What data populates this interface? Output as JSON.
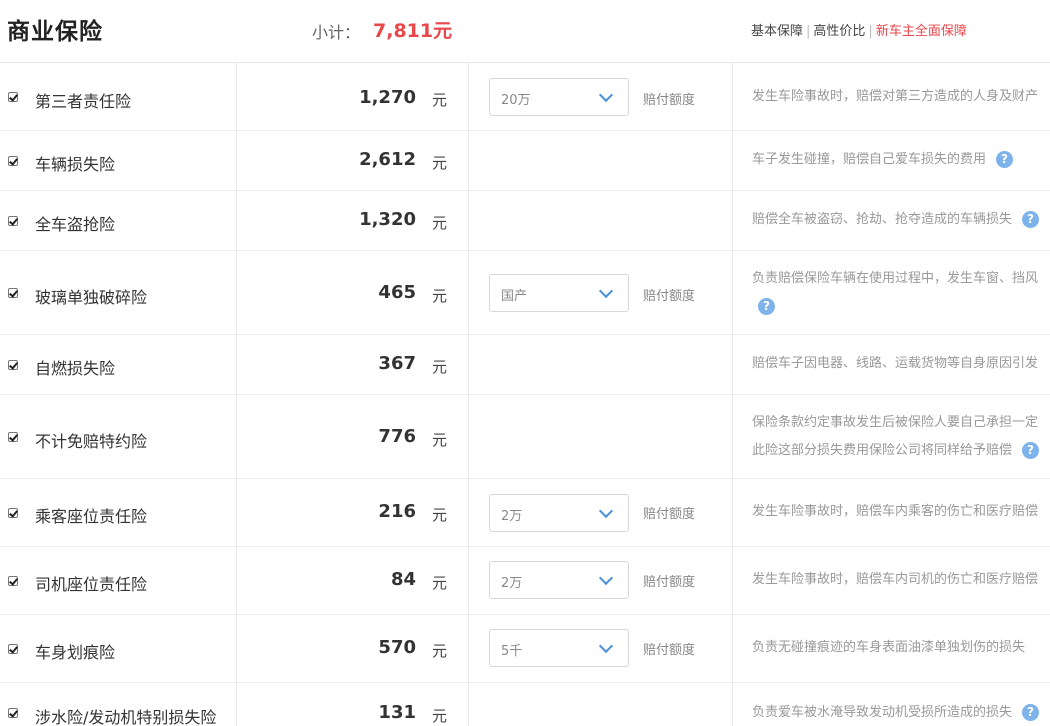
{
  "header": {
    "title": "商业保险",
    "subtotal_label": "小计：",
    "subtotal_value": "7,811元",
    "filters": [
      "基本保障",
      "高性价比",
      "新车主全面保障"
    ]
  },
  "unit": "元",
  "limit_label": "赔付额度",
  "items": [
    {
      "name": "第三者责任险",
      "price": "1,270",
      "select": "20万",
      "desc1": "发生车险事故时，赔偿对第三方造成的人身及财产",
      "desc2": ""
    },
    {
      "name": "车辆损失险",
      "price": "2,612",
      "select": "",
      "desc1": "车子发生碰撞，赔偿自己爱车损失的费用",
      "desc2": ""
    },
    {
      "name": "全车盗抢险",
      "price": "1,320",
      "select": "",
      "desc1": "赔偿全车被盗窃、抢劫、抢夺造成的车辆损失",
      "desc2": ""
    },
    {
      "name": "玻璃单独破碎险",
      "price": "465",
      "select": "国产",
      "desc1": "负责赔偿保险车辆在使用过程中，发生车窗、挡风",
      "desc2": ""
    },
    {
      "name": "自燃损失险",
      "price": "367",
      "select": "",
      "desc1": "赔偿车子因电器、线路、运载货物等自身原因引发",
      "desc2": ""
    },
    {
      "name": "不计免赔特约险",
      "price": "776",
      "select": "",
      "desc1": "保险条款约定事故发生后被保险人要自己承担一定",
      "desc2": "此险这部分损失费用保险公司将同样给予赔偿"
    },
    {
      "name": "乘客座位责任险",
      "price": "216",
      "select": "2万",
      "desc1": "发生车险事故时，赔偿车内乘客的伤亡和医疗赔偿",
      "desc2": ""
    },
    {
      "name": "司机座位责任险",
      "price": "84",
      "select": "2万",
      "desc1": "发生车险事故时，赔偿车内司机的伤亡和医疗赔偿",
      "desc2": ""
    },
    {
      "name": "车身划痕险",
      "price": "570",
      "select": "5千",
      "desc1": "负责无碰撞痕迹的车身表面油漆单独划伤的损失",
      "desc2": ""
    },
    {
      "name": "涉水险/发动机特别损失险",
      "price": "131",
      "select": "",
      "desc1": "负责爱车被水淹导致发动机受损所造成的损失",
      "desc2": ""
    }
  ]
}
